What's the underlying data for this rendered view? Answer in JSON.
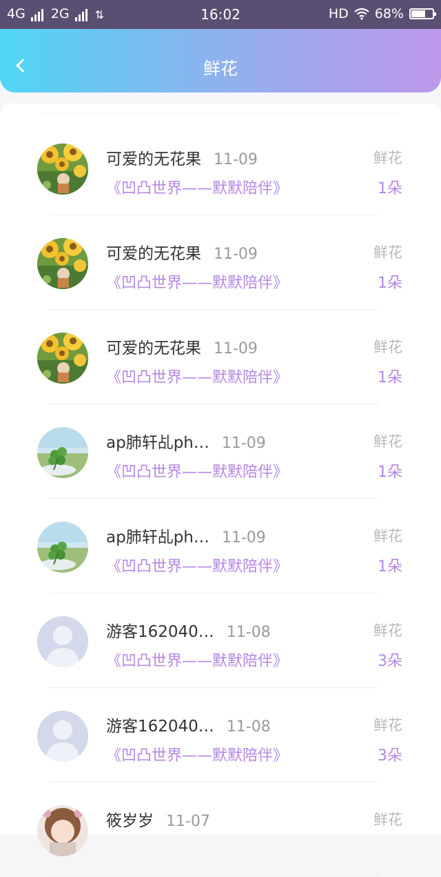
{
  "status_bar": {
    "network1": "4G",
    "network2": "2G",
    "extra_icon": "signal-alt-icon",
    "time": "16:02",
    "hd": "HD",
    "battery_percent": "68%",
    "battery_level": 0.68
  },
  "header": {
    "title": "鲜花",
    "back_icon": "chevron-left-icon",
    "gradient": [
      "#4fd6f4",
      "#bd97ea"
    ]
  },
  "items": [
    {
      "name": "可爱的无花果",
      "date": "11-09",
      "gift": "《凹凸世界——默默陪伴》",
      "type": "鲜花",
      "count": "1朵",
      "avatar": "sunflower"
    },
    {
      "name": "可爱的无花果",
      "date": "11-09",
      "gift": "《凹凸世界——默默陪伴》",
      "type": "鲜花",
      "count": "1朵",
      "avatar": "sunflower"
    },
    {
      "name": "可爱的无花果",
      "date": "11-09",
      "gift": "《凹凸世界——默默陪伴》",
      "type": "鲜花",
      "count": "1朵",
      "avatar": "sunflower"
    },
    {
      "name": "ap肺轩乩ph…",
      "date": "11-09",
      "gift": "《凹凸世界——默默陪伴》",
      "type": "鲜花",
      "count": "1朵",
      "avatar": "clover"
    },
    {
      "name": "ap肺轩乩ph…",
      "date": "11-09",
      "gift": "《凹凸世界——默默陪伴》",
      "type": "鲜花",
      "count": "1朵",
      "avatar": "clover"
    },
    {
      "name": "游客162040…",
      "date": "11-08",
      "gift": "《凹凸世界——默默陪伴》",
      "type": "鲜花",
      "count": "3朵",
      "avatar": "default"
    },
    {
      "name": "游客162040…",
      "date": "11-08",
      "gift": "《凹凸世界——默默陪伴》",
      "type": "鲜花",
      "count": "3朵",
      "avatar": "default"
    },
    {
      "name": "筱岁岁",
      "date": "11-07",
      "gift": "",
      "type": "鲜花",
      "count": "",
      "avatar": "anime"
    }
  ],
  "colors": {
    "accent": "#b586e3",
    "date": "#9a9a9a",
    "type": "#b8b8b8"
  }
}
